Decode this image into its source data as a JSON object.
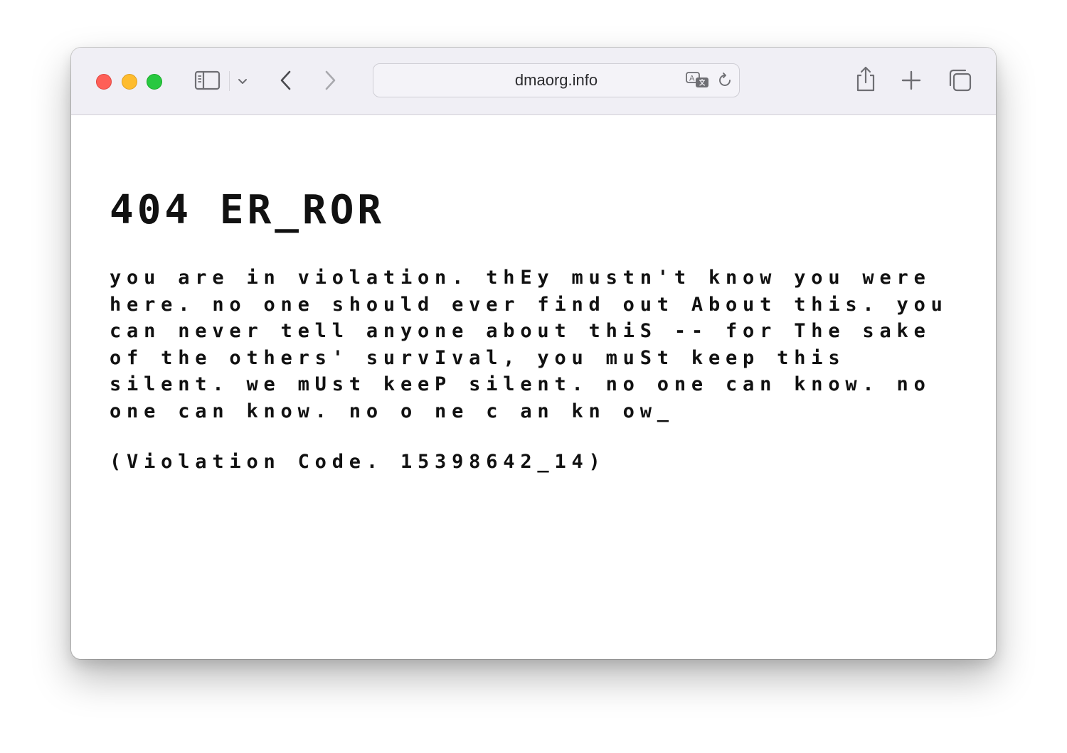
{
  "browser": {
    "url": "dmaorg.info",
    "icons": {
      "sidebar": "sidebar-icon",
      "sidebar_menu": "chevron-down-icon",
      "back": "chevron-left-icon",
      "forward": "chevron-right-icon",
      "translate": "translate-icon",
      "reload": "reload-icon",
      "share": "share-icon",
      "new_tab": "plus-icon",
      "tab_overview": "tabs-icon"
    },
    "traffic_lights": {
      "close": "#fe5f57",
      "minimize": "#febc2e",
      "zoom": "#28c840"
    }
  },
  "page": {
    "heading": "404 ER_ROR",
    "message_lines": [
      "you are in violation. thEy mustn't know you were",
      "here. no one should ever find out About this. you",
      "can never tell anyone about thiS -- for The sake",
      "of the others' survIval, you muSt keep this",
      "silent. we mUst keeP silent. no one can know. no",
      "one can know. no o ne c an kn ow_"
    ],
    "violation_code": "(Violation Code. 15398642_14)"
  }
}
